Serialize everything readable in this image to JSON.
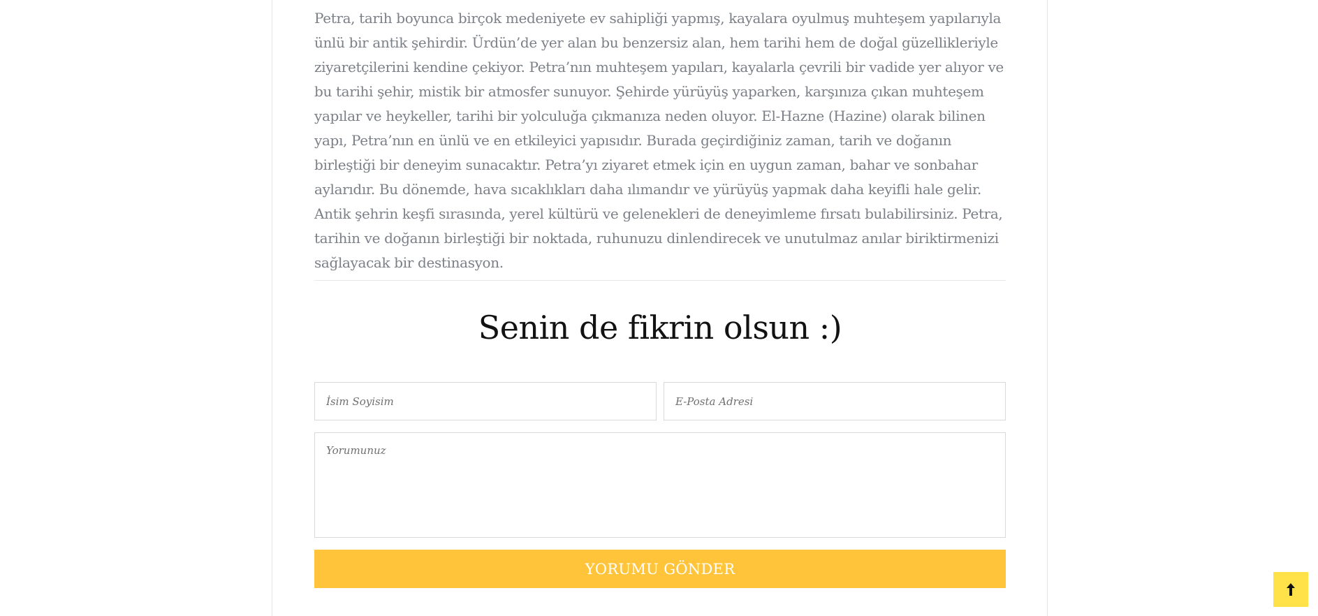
{
  "article": {
    "paragraph": "Petra, tarih boyunca birçok medeniyete ev sahipliği yapmış, kayalara oyulmuş muhteşem yapılarıyla ünlü bir antik şehirdir. Ürdün’de yer alan bu benzersiz alan, hem tarihi hem de doğal güzellikleriyle ziyaretçilerini kendine çekiyor. Petra’nın muhteşem yapıları, kayalarla çevrili bir vadide yer alıyor ve bu tarihi şehir, mistik bir atmosfer sunuyor. Şehirde yürüyüş yaparken, karşınıza çıkan muhteşem yapılar ve heykeller, tarihi bir yolculuğa çıkmanıza neden oluyor. El-Hazne (Hazine) olarak bilinen yapı, Petra’nın en ünlü ve en etkileyici yapısıdır. Burada geçirdiğiniz zaman, tarih ve doğanın birleştiği bir deneyim sunacaktır. Petra’yı ziyaret etmek için en uygun zaman, bahar ve sonbahar aylarıdır. Bu dönemde, hava sıcaklıkları daha ılımandır ve yürüyüş yapmak daha keyifli hale gelir. Antik şehrin keşfi sırasında, yerel kültürü ve gelenekleri de deneyimleme fırsatı bulabilirsiniz. Petra, tarihin ve doğanın birleştiği bir noktada, ruhunuzu dinlendirecek ve unutulmaz anılar biriktirmenizi sağlayacak bir destinasyon."
  },
  "comment_form": {
    "title": "Senin de fikrin olsun :)",
    "name_placeholder": "İsim Soyisim",
    "email_placeholder": "E-Posta Adresi",
    "comment_placeholder": "Yorumunuz",
    "submit_label": "YORUMU GÖNDER"
  },
  "icons": {
    "scroll_top": "arrow-up-icon"
  },
  "colors": {
    "accent_button": "#ffc43a",
    "scroll_top_button": "#ffe24a"
  }
}
